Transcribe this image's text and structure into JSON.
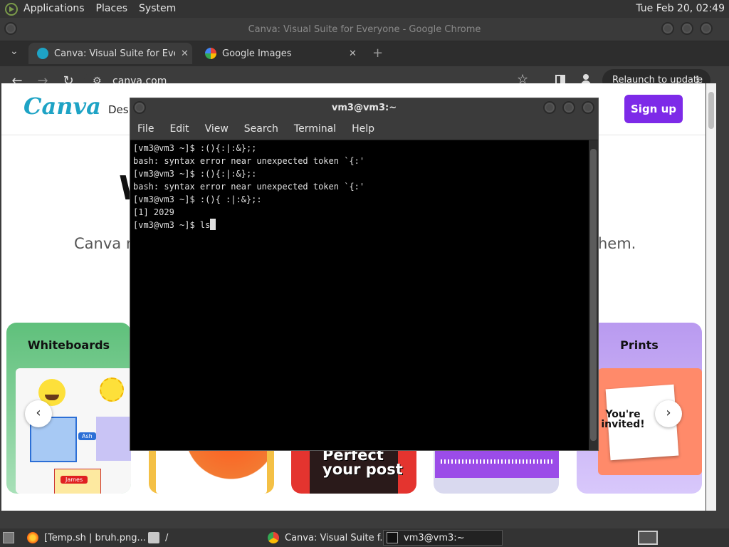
{
  "top_panel": {
    "menu": [
      "Applications",
      "Places",
      "System"
    ],
    "clock": "Tue Feb 20, 02:49"
  },
  "chrome": {
    "window_title": "Canva: Visual Suite for Everyone - Google Chrome",
    "tabs": [
      {
        "title": "Canva: Visual Suite for Everyone",
        "close": "✕",
        "active": true
      },
      {
        "title": "Google Images",
        "close": "✕",
        "active": false
      }
    ],
    "new_tab": "+",
    "url": "canva.com",
    "relaunch_label": "Relaunch to update"
  },
  "page": {
    "logo": "Canva",
    "nav_item": "Desi",
    "signup_label": "Sign up",
    "hero_title_fragment": "W",
    "hero_sub_left": "Canva m",
    "hero_sub_right": "hem.",
    "cards": [
      {
        "title": "Whiteboards"
      },
      {
        "title": "Prints"
      }
    ],
    "whiteboard_tags": [
      "Ash",
      "James"
    ],
    "card3_text": "Perfect your post",
    "prints_text": "You're invited!",
    "carousel_prev": "‹",
    "carousel_next": "›"
  },
  "terminal": {
    "title": "vm3@vm3:~",
    "menu": [
      "File",
      "Edit",
      "View",
      "Search",
      "Terminal",
      "Help"
    ],
    "lines": [
      "[vm3@vm3 ~]$ :(){:|:&};;",
      "bash: syntax error near unexpected token `{:'",
      "[vm3@vm3 ~]$ :(){:|:&};:",
      "bash: syntax error near unexpected token `{:'",
      "[vm3@vm3 ~]$ :(){ :|:&};:",
      "[1] 2029"
    ],
    "current_prompt": "[vm3@vm3 ~]$ ",
    "current_input": "ls"
  },
  "taskbar": {
    "items": [
      {
        "label": "[Temp.sh | bruh.png..."
      },
      {
        "label": "/"
      },
      {
        "label": "Canva: Visual Suite f..."
      },
      {
        "label": "vm3@vm3:~"
      }
    ]
  },
  "colors": {
    "canva_purple": "#7d2ae8",
    "canva_teal": "#1ea3c5",
    "terminal_bg": "#000000"
  }
}
